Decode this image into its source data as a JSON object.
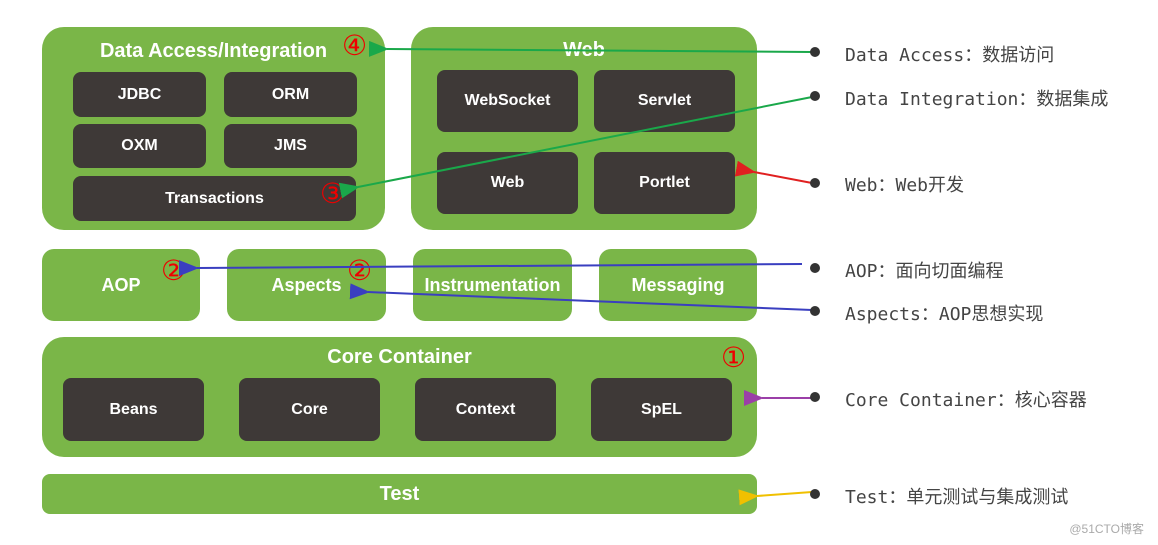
{
  "groups": {
    "data_access": {
      "title": "Data Access/Integration",
      "modules": [
        "JDBC",
        "ORM",
        "OXM",
        "JMS",
        "Transactions"
      ],
      "marker": "④"
    },
    "web": {
      "title": "Web",
      "modules": [
        "WebSocket",
        "Servlet",
        "Web",
        "Portlet"
      ]
    },
    "middle": {
      "items": [
        "AOP",
        "Aspects",
        "Instrumentation",
        "Messaging"
      ],
      "markers": [
        "②",
        "②"
      ]
    },
    "core": {
      "title": "Core Container",
      "modules": [
        "Beans",
        "Core",
        "Context",
        "SpEL"
      ],
      "marker": "①"
    },
    "test": {
      "title": "Test"
    },
    "transactions_marker": "③"
  },
  "notes": [
    "Data Access：数据访问",
    "Data Integration：数据集成",
    "Web：Web开发",
    "AOP：面向切面编程",
    "Aspects：AOP思想实现",
    "Core Container：核心容器",
    "Test：单元测试与集成测试"
  ],
  "colors": {
    "group": "#7ab648",
    "module": "#3e3937",
    "marker": "#e00000",
    "green_arrow": "#1aa84a",
    "red_arrow": "#e02020",
    "blue_arrow": "#3a3fc0",
    "purple_arrow": "#9b3fa8",
    "yellow_arrow": "#f0c000"
  },
  "watermark": "@51CTO博客"
}
